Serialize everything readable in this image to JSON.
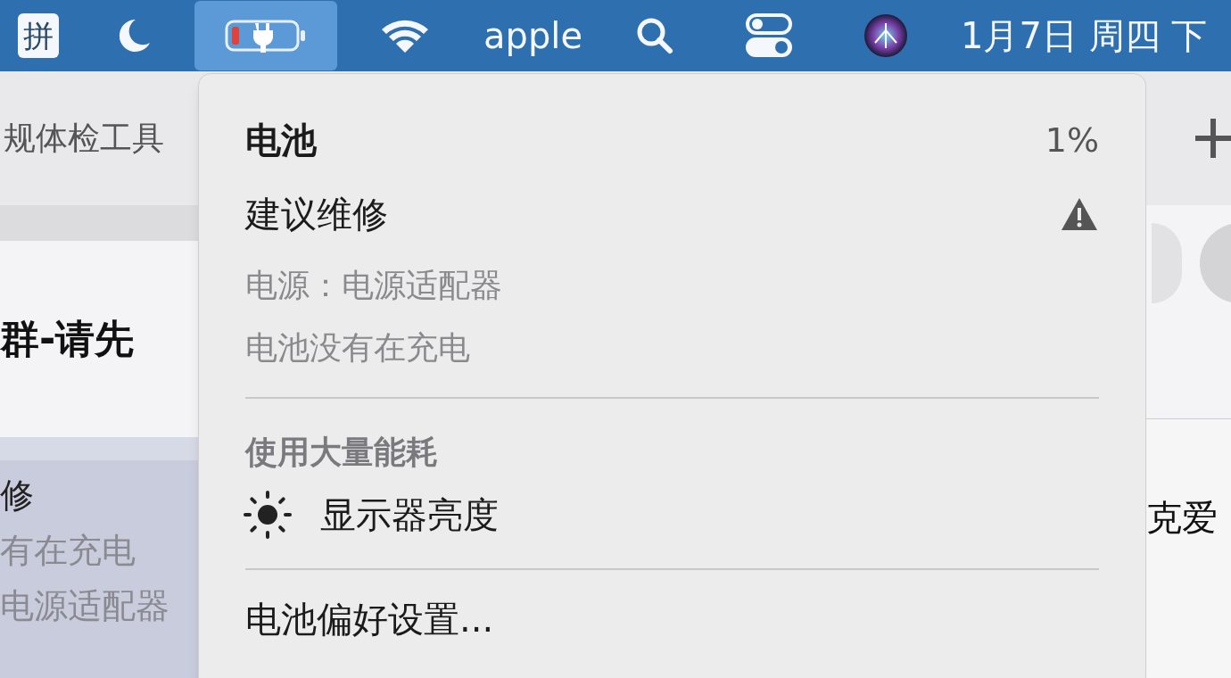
{
  "menu_bar": {
    "items": [
      {
        "kind": "input",
        "label": "拼",
        "selected": false
      },
      {
        "kind": "moon",
        "selected": false
      },
      {
        "kind": "battery",
        "selected": true
      },
      {
        "kind": "wifi",
        "selected": false
      },
      {
        "kind": "text",
        "label": "apple",
        "selected": false
      },
      {
        "kind": "search",
        "selected": false
      },
      {
        "kind": "control",
        "selected": false
      },
      {
        "kind": "siri",
        "selected": false
      },
      {
        "kind": "text",
        "label": "1月7日 周四 下",
        "selected": false
      }
    ]
  },
  "background_left": {
    "title": "规体检工具",
    "heading": "群-请先",
    "lines": [
      "修",
      "有在充电",
      "电源适配器"
    ]
  },
  "background_right": {
    "text": "克爱"
  },
  "battery_menu": {
    "title": "电池",
    "percent": "1%",
    "condition": "建议维修",
    "details": [
      "电源：电源适配器",
      "电池没有在充电"
    ],
    "section": "使用大量能耗",
    "apps": [
      "显示器亮度"
    ],
    "footer": "电池偏好设置..."
  }
}
